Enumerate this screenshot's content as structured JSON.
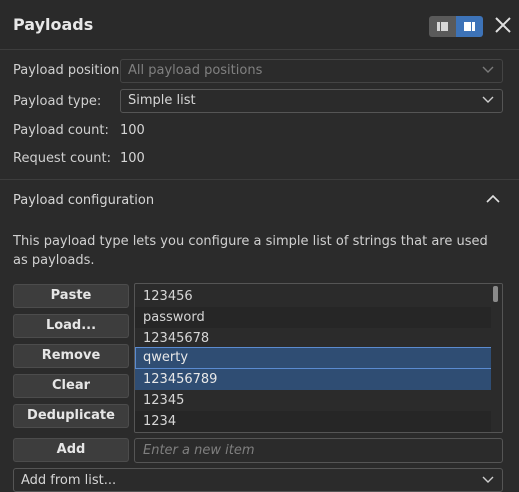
{
  "header": {
    "title": "Payloads"
  },
  "settings": {
    "position_label": "Payload position:",
    "position_value": "All payload positions",
    "type_label": "Payload type:",
    "type_value": "Simple list",
    "count_label": "Payload count:",
    "count_value": "100",
    "request_label": "Request count:",
    "request_value": "100"
  },
  "config": {
    "title": "Payload configuration",
    "description": "This payload type lets you configure a simple list of strings that are used as payloads."
  },
  "buttons": {
    "paste": "Paste",
    "load": "Load...",
    "remove": "Remove",
    "clear": "Clear",
    "deduplicate": "Deduplicate",
    "add": "Add"
  },
  "list": {
    "items": [
      "123456",
      "password",
      "12345678",
      "qwerty",
      "123456789",
      "12345",
      "1234"
    ],
    "selected": [
      "qwerty",
      "123456789"
    ]
  },
  "new_item": {
    "placeholder": "Enter a new item"
  },
  "add_from_list": {
    "label": "Add from list..."
  },
  "icons": {
    "toggle_left": "list-layout-icon",
    "toggle_right": "panel-layout-icon",
    "close": "close-icon",
    "chevron": "chevron-down-icon",
    "collapse": "chevron-up-icon"
  },
  "colors": {
    "background": "#2b2b2b",
    "accent": "#3d73b8",
    "selection": "#2f4d73"
  }
}
